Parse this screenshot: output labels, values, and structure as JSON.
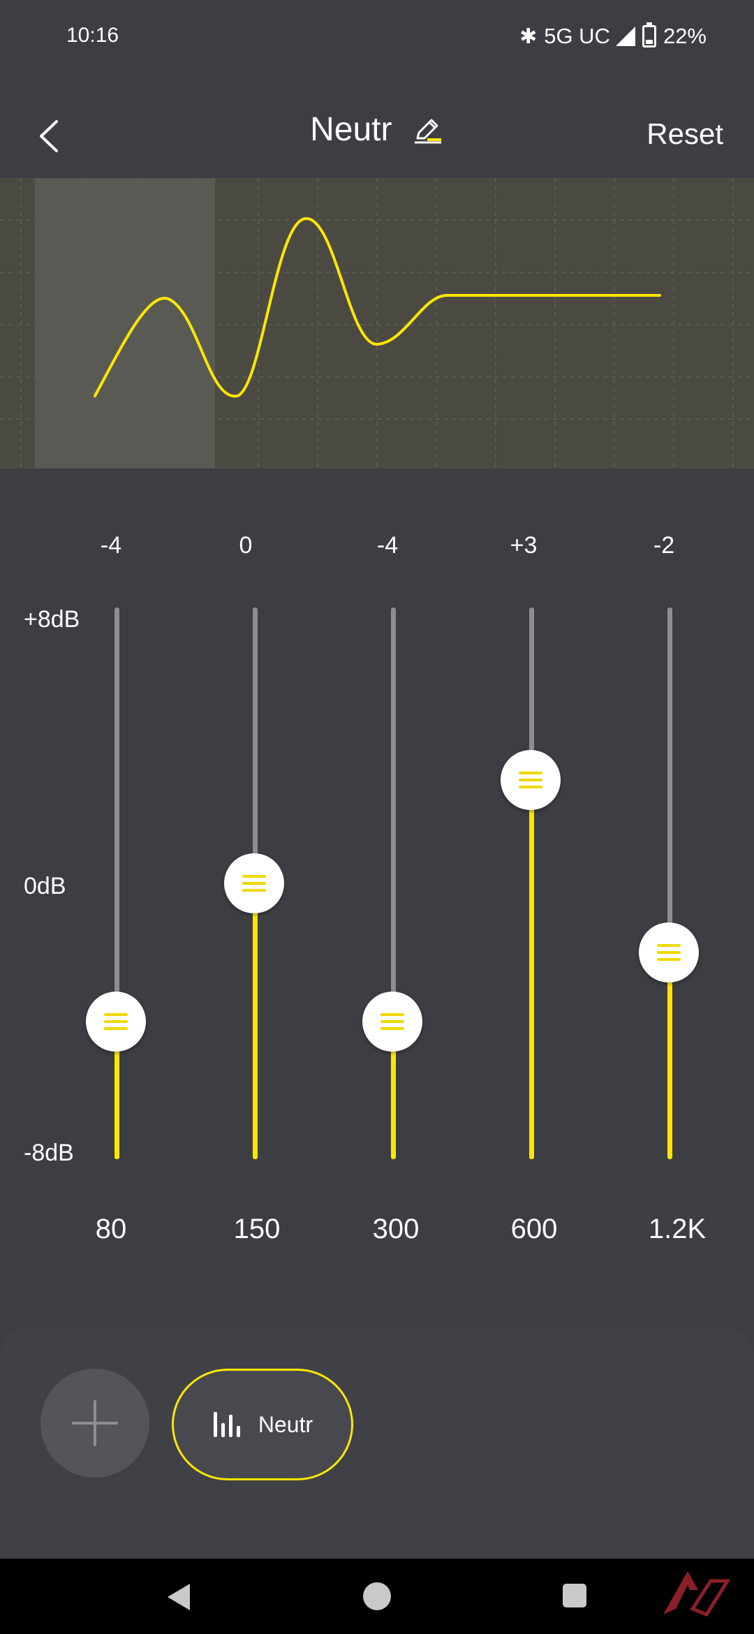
{
  "status_bar": {
    "time": "10:16",
    "network": "5G UC",
    "battery": "22%",
    "icons": [
      "bluetooth-icon",
      "signal-icon",
      "battery-icon"
    ]
  },
  "header": {
    "title": "Neutr",
    "reset_label": "Reset",
    "icons": [
      "back-arrow-icon",
      "edit-pencil-icon"
    ]
  },
  "db_scale": {
    "top": "+8dB",
    "mid": "0dB",
    "bottom": "-8dB",
    "range": [
      -8,
      8
    ]
  },
  "bands": [
    {
      "freq": "80",
      "label": "-4",
      "gain": -4
    },
    {
      "freq": "150",
      "label": "0",
      "gain": 0
    },
    {
      "freq": "300",
      "label": "-4",
      "gain": -4
    },
    {
      "freq": "600",
      "label": "+3",
      "gain": 3
    },
    {
      "freq": "1.2K",
      "label": "-2",
      "gain": -2
    }
  ],
  "presets": {
    "active": "Neutr",
    "icons": [
      "add-icon",
      "equalizer-icon"
    ]
  },
  "colors": {
    "background": "#3d3e43",
    "accent": "#ffe600",
    "track": "#8d8e92",
    "curve_panel": "#4b4a42"
  }
}
